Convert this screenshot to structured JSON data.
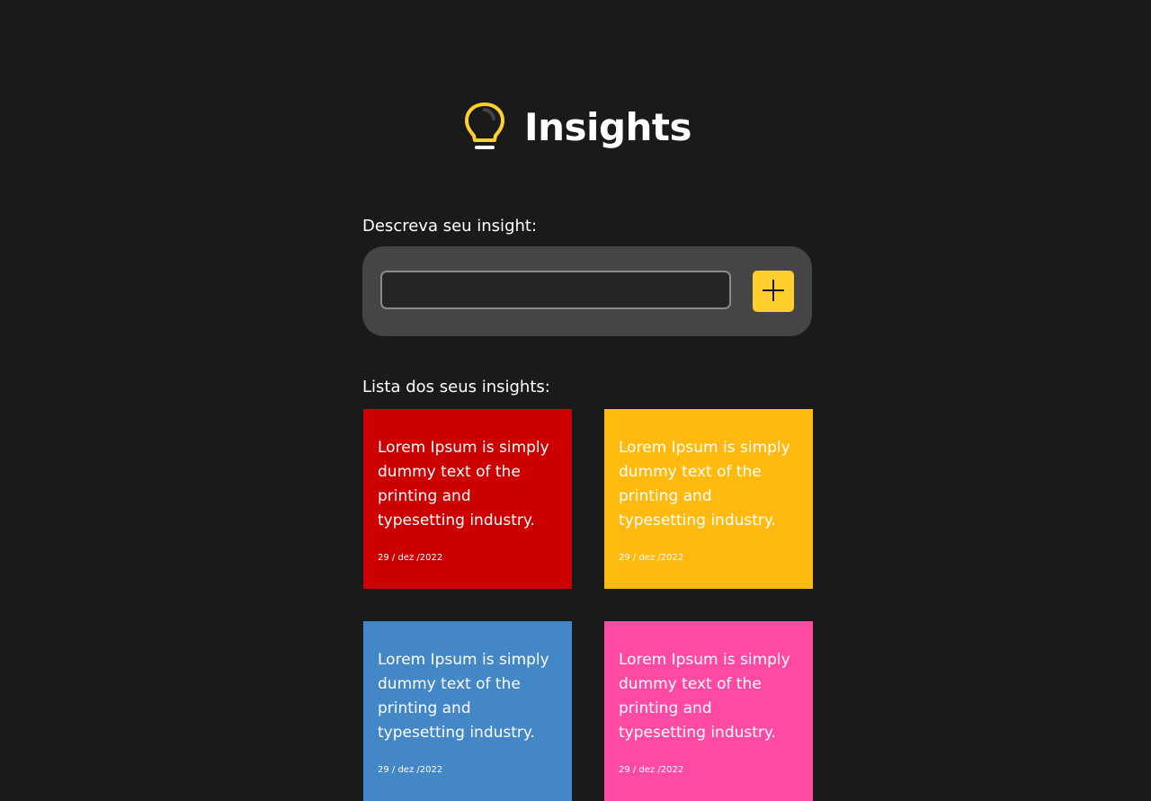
{
  "header": {
    "title": "Insights",
    "icon": "lightbulb-icon",
    "icon_color": "#ffcf2e"
  },
  "form": {
    "label": "Descreva seu insight:",
    "input_value": "",
    "input_placeholder": "",
    "add_button_icon": "plus-icon",
    "button_color": "#ffcf2e"
  },
  "list": {
    "label": "Lista dos seus insights:",
    "cards": [
      {
        "text": "Lorem Ipsum is simply dummy text of the printing and typesetting industry.",
        "date": "29 / dez /2022",
        "color": "#cc0000"
      },
      {
        "text": "Lorem Ipsum is simply dummy text of the printing and typesetting industry.",
        "date": "29 / dez /2022",
        "color": "#ffb90f"
      },
      {
        "text": "Lorem Ipsum is simply dummy text of the printing and typesetting industry.",
        "date": "29 / dez /2022",
        "color": "#4387c6"
      },
      {
        "text": "Lorem Ipsum is simply dummy text of the printing and typesetting industry.",
        "date": "29 / dez /2022",
        "color": "#ff4aa3"
      }
    ]
  }
}
